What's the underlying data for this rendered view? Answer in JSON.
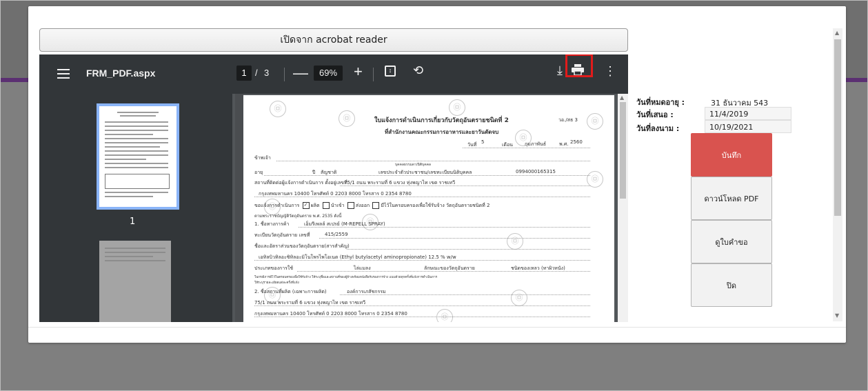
{
  "modal": {
    "open_acrobat_label": "เปิดจาก acrobat reader"
  },
  "pdf_toolbar": {
    "file_name": "FRM_PDF.aspx",
    "current_page": "1",
    "page_separator": "/",
    "total_pages": "3",
    "zoom_out": "—",
    "zoom_level": "69%",
    "zoom_in": "+",
    "more_symbol": "⋮",
    "download_symbol": "⤓",
    "rotate_symbol": "⟲",
    "highlight_color": "#e11b1b"
  },
  "thumbnails": {
    "page_1_label": "1"
  },
  "document": {
    "title_line1": "ใบแจ้งการดำเนินการเกี่ยวกับวัตถุอันตรายชนิดที่ 2",
    "title_line2": "ที่สำนักงานคณะกรรมการอาหารและยาวันตัดจบ",
    "form_code": "วอ./สธ 3",
    "date_day_label": "วันที่",
    "date_day": "5",
    "date_month_label": "เดือน",
    "date_month": "กุมภาพันธ์",
    "date_year_label": "พ.ศ.",
    "date_year": "2560",
    "applicant_label": "ข้าพเจ้า",
    "person_type_note": "บุคคลธรรมดา/นิติบุคคล",
    "age_label": "อายุ",
    "age_value": "ปี",
    "nationality_label": "สัญชาติ",
    "id_label": "เลขประจำตัวประชาชน/เลขทะเบียนนิติบุคคล",
    "id_value": "0994000165315",
    "place_label": "สถานที่ติดต่อผู้แจ้งการดำเนินการ ตั้งอยู่เลขที่",
    "address_line1": "75/1 ถนน พระรามที่ 6 แขวง ทุ่งพญาไท เขต ราชเทวี",
    "address_line2": "กรุงเทพมหานคร 10400 โทรศัพท์ 0 2203 8000 โทรสาร 0 2354 8780",
    "operation_label": "ขอแจ้งการดำเนินการ",
    "opt_produce": "ผลิต",
    "opt_import": "นำเข้า",
    "opt_export": "ส่งออก",
    "opt_possess": "มีไว้ในครอบครองเพื่อใช้รับจ้าง วัตถุอันตรายชนิดที่ 2",
    "law_ref": "ตามพระราชบัญญัติวัตถุอันตราย พ.ศ. 2535 ดังนี้",
    "item1_label": "1. ชื่อทางการค้า",
    "item1_value": "เอ็มรีเพลล์ สเปรย์ (M-REPELL SPRAY)",
    "reg_label": "ทะเบียนวัตถุอันตราย เลขที่",
    "reg_value": "415/2559",
    "ingredients_label": "ชื่อและอัตราส่วนของวัตถุอันตราย(สารสำคัญ)",
    "ingredient_value": "เอทิลบิวทิลอะซิทิลอะมิโนโพรไพโอเนต (Ethyl butylacetyl aminopropionate) 12.5 % w/w",
    "usage_label": "ประเภทของการใช้",
    "usage_value": "ไล่แมลง",
    "form_label": "ลักษณะของวัตถุอันตราย",
    "form_value": "ชนิดของเหลว (ทาผิวหนัง)",
    "note_line1": "ในกรณีการมีไว้ในครอบครองเพื่อใช้รับจ้าง ให้ระบุชื่อและสถานที่ของผู้จ้างพร้อมหนังสือรับรองการจ้าง แนบด้วยทุกครั้งที่แจ้งการดำเนินการ",
    "note_line2": "ให้ระบุรายละเอียดแต่ละครั้งที่แจ้ง",
    "item2_label": "2. ชื่อสถานที่ผลิต (เฉพาะการผลิต)",
    "item2_value": "องค์การเภสัชกรรม",
    "item2_addr1": "75/1 ถนน พระรามที่ 6 แขวง ทุ่งพญาไท เขต ราชเทวี",
    "item2_addr2": "กรุงเทพมหานคร 10400 โทรศัพท์ 0 2203 8000 โทรสาร 0 2354 8780"
  },
  "info_panel": {
    "expiry_label": "วันที่หมดอายุ :",
    "expiry_value": "31 ธันวาคม 543",
    "submit_label": "วันที่เสนอ :",
    "submit_value": "11/4/2019",
    "sign_label": "วันที่ลงนาม :",
    "sign_value": "10/19/2021"
  },
  "buttons": {
    "save": "บันทึก",
    "download_pdf": "ดาวน์โหลด PDF",
    "view_request": "ดูใบคำขอ",
    "close": "ปิด"
  },
  "colors": {
    "save_button": "#d9534f",
    "pdf_toolbar": "#323639",
    "page_header_accent": "#5b2f72"
  }
}
